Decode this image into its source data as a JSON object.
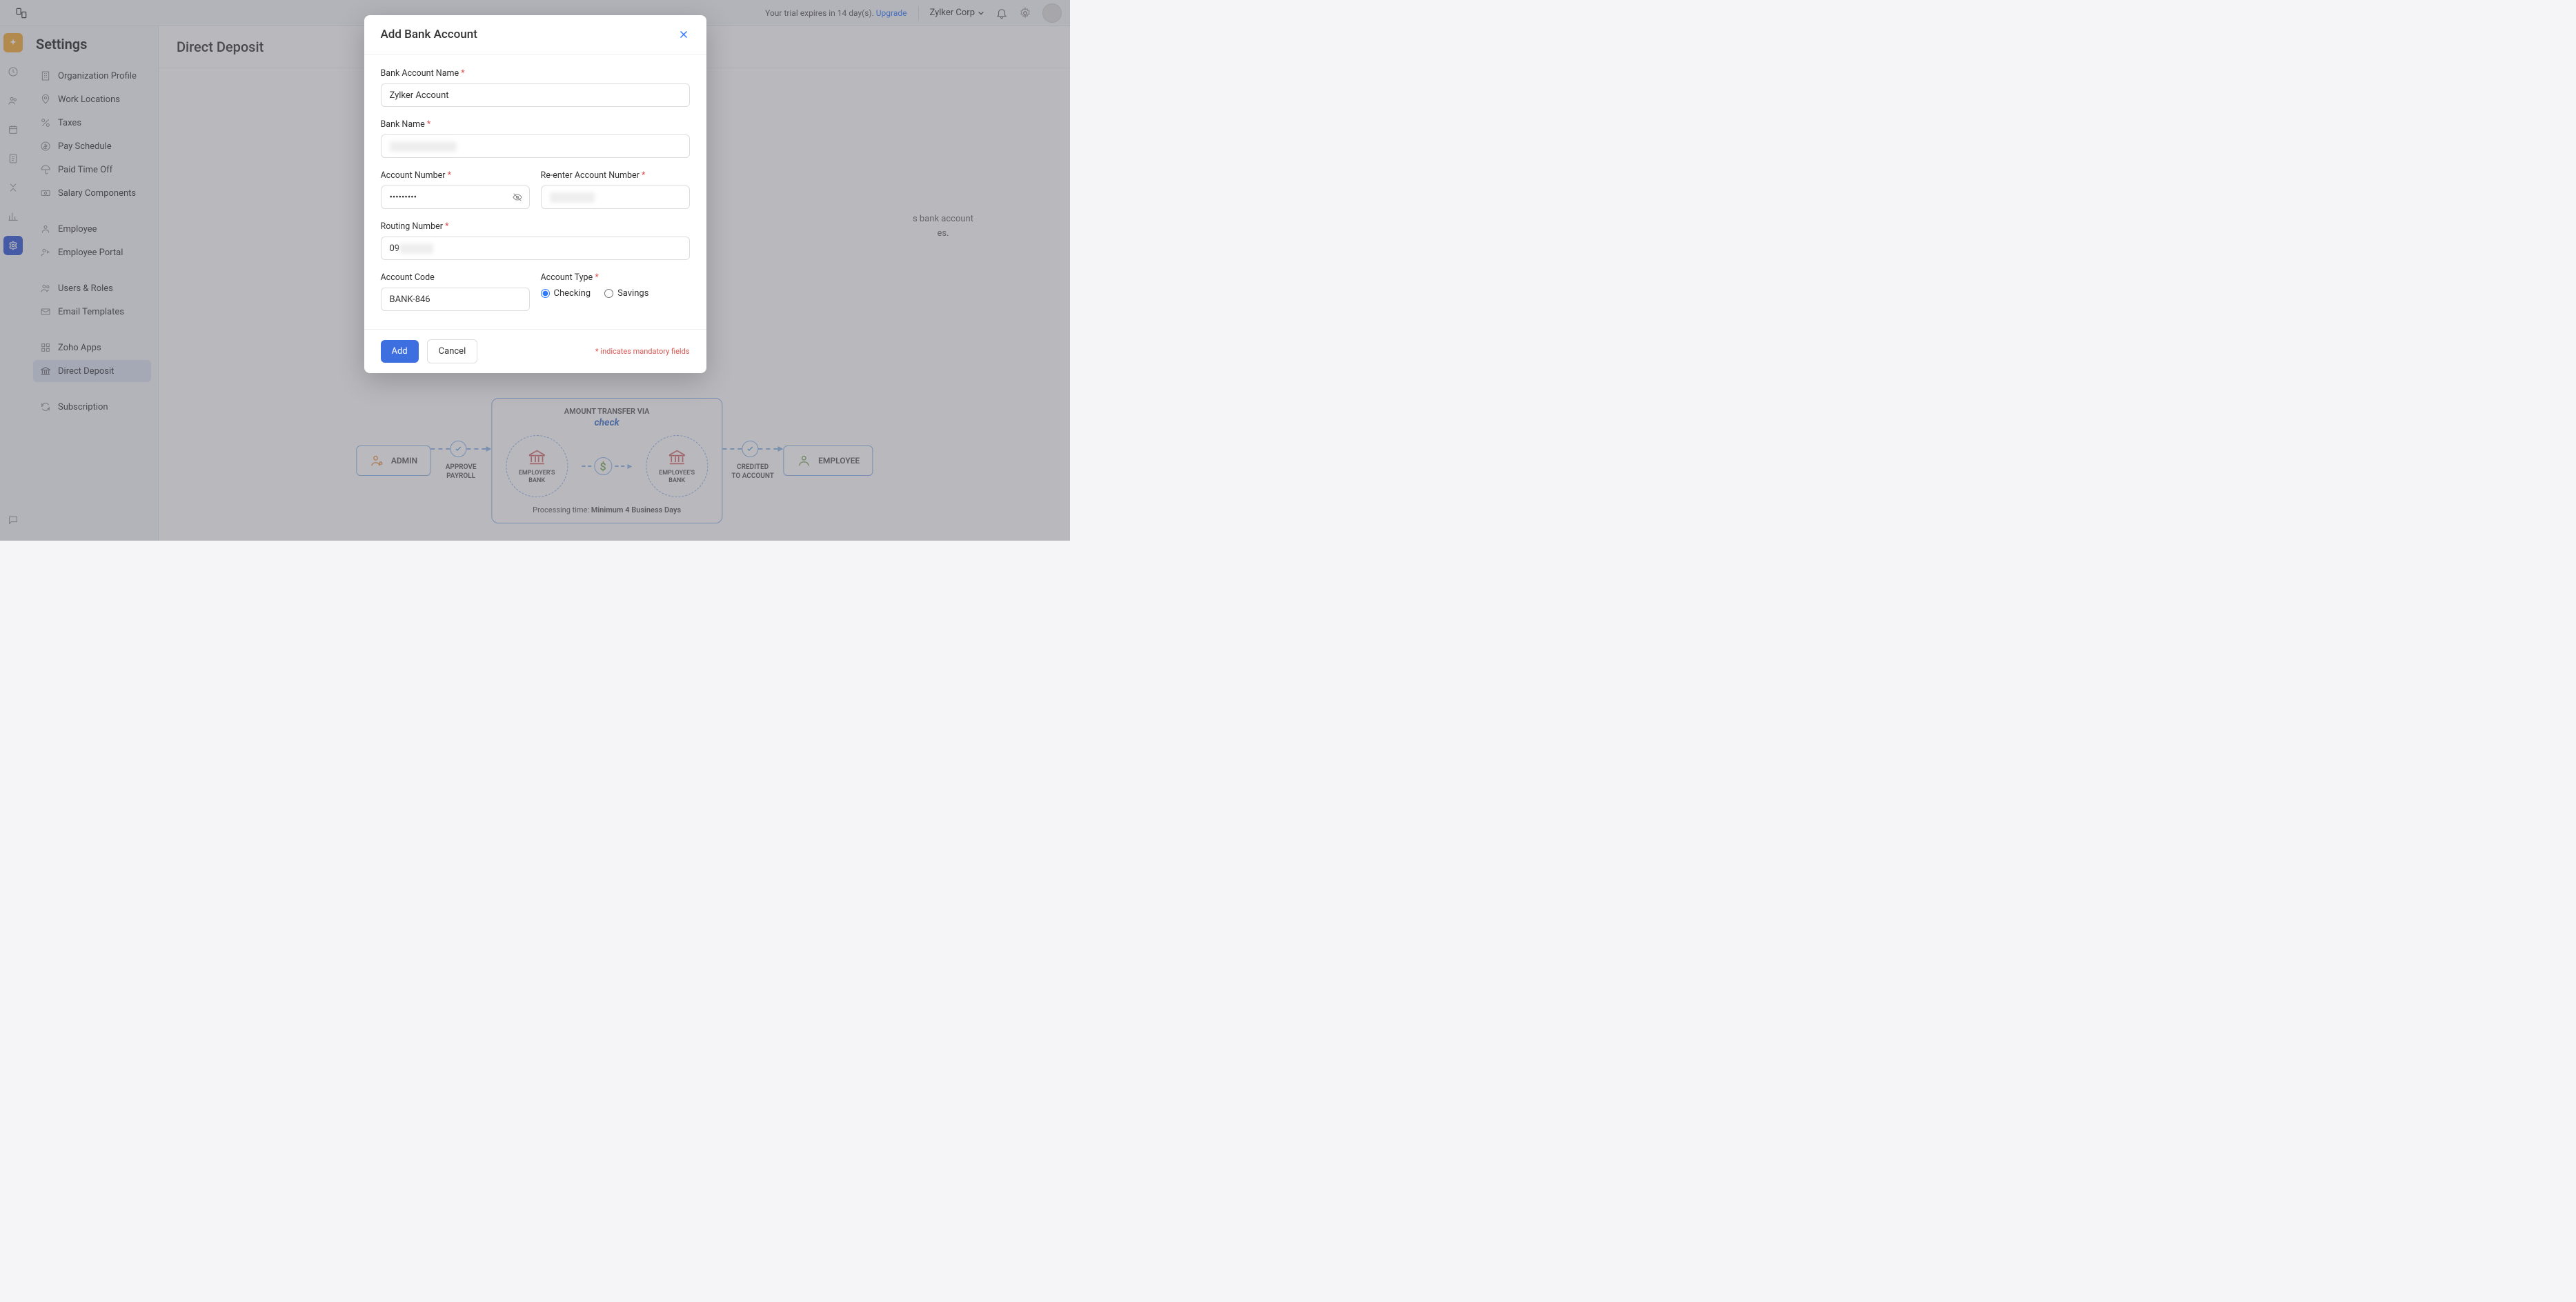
{
  "topbar": {
    "trial_text": "Your trial expires in 14 day(s). ",
    "upgrade": "Upgrade",
    "org_name": "Zylker Corp"
  },
  "settings": {
    "title": "Settings",
    "items": {
      "org_profile": "Organization Profile",
      "work_locations": "Work Locations",
      "taxes": "Taxes",
      "pay_schedule": "Pay Schedule",
      "paid_time_off": "Paid Time Off",
      "salary_components": "Salary Components",
      "employee": "Employee",
      "employee_portal": "Employee Portal",
      "users_roles": "Users & Roles",
      "email_templates": "Email Templates",
      "zoho_apps": "Zoho Apps",
      "direct_deposit": "Direct Deposit",
      "subscription": "Subscription"
    }
  },
  "content": {
    "title": "Direct Deposit",
    "behind_text_1": "s bank account",
    "behind_text_2": "es."
  },
  "modal": {
    "title": "Add Bank Account",
    "fields": {
      "bank_account_name": {
        "label": "Bank Account Name",
        "value": "Zylker Account"
      },
      "bank_name": {
        "label": "Bank Name",
        "value": "XXXXXXXXXXXX"
      },
      "account_number": {
        "label": "Account Number",
        "value": "•••••••••"
      },
      "reenter_account_number": {
        "label": "Re-enter Account Number",
        "value": "XXXXXXXX"
      },
      "routing_number": {
        "label": "Routing Number",
        "prefix": "09",
        "suffix": "XXXXXX"
      },
      "account_code": {
        "label": "Account Code",
        "value": "BANK-846"
      },
      "account_type": {
        "label": "Account Type",
        "checking": "Checking",
        "savings": "Savings"
      }
    },
    "footer": {
      "add": "Add",
      "cancel": "Cancel",
      "mandatory": "* indicates mandatory fields"
    }
  },
  "diagram": {
    "admin": "ADMIN",
    "approve_payroll": "APPROVE\nPAYROLL",
    "transfer_title": "AMOUNT TRANSFER VIA",
    "transfer_logo": "check",
    "employer_bank": "EMPLOYER'S\nBANK",
    "employee_bank": "EMPLOYEE'S\nBANK",
    "credited": "CREDITED\nTO ACCOUNT",
    "employee": "EMPLOYEE",
    "processing_label": "Processing time: ",
    "processing_value": "Minimum 4 Business Days"
  }
}
